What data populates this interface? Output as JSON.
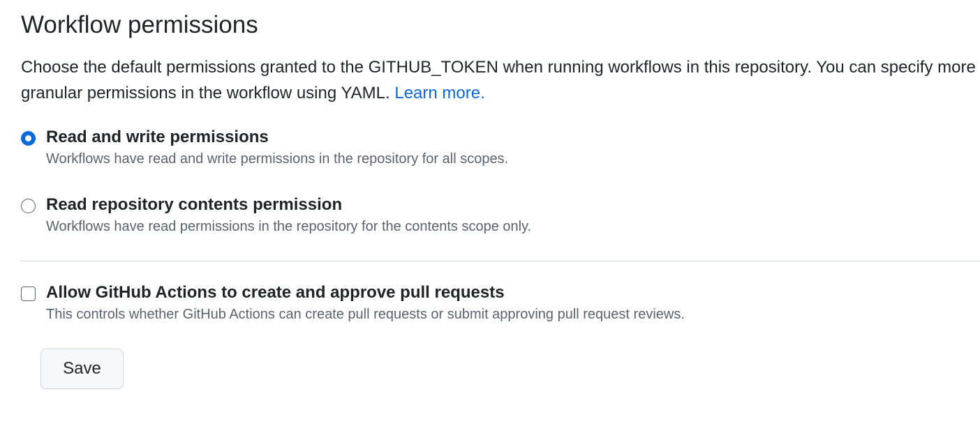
{
  "section": {
    "title": "Workflow permissions",
    "intro": "Choose the default permissions granted to the GITHUB_TOKEN when running workflows in this repository. You can specify more granular permissions in the workflow using YAML.",
    "learn_more": "Learn more."
  },
  "permissions": [
    {
      "label": "Read and write permissions",
      "note": "Workflows have read and write permissions in the repository for all scopes.",
      "selected": true
    },
    {
      "label": "Read repository contents permission",
      "note": "Workflows have read permissions in the repository for the contents scope only.",
      "selected": false
    }
  ],
  "pull_requests": {
    "label": "Allow GitHub Actions to create and approve pull requests",
    "note": "This controls whether GitHub Actions can create pull requests or submit approving pull request reviews.",
    "checked": false
  },
  "actions": {
    "save_label": "Save"
  },
  "colors": {
    "accent": "#0969da",
    "text": "#1f2328",
    "muted": "#59636e",
    "border": "#d1d9e0",
    "button_bg": "#f6f8fa"
  }
}
